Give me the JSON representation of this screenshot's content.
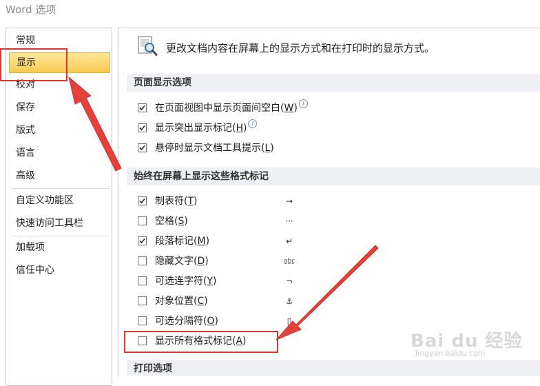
{
  "window": {
    "title": "Word 选项"
  },
  "sidebar": {
    "items": [
      {
        "label": "常规"
      },
      {
        "label": "显示",
        "selected": true
      },
      {
        "label": "校对"
      },
      {
        "label": "保存"
      },
      {
        "label": "版式"
      },
      {
        "label": "语言"
      },
      {
        "label": "高级"
      },
      {
        "label": "自定义功能区"
      },
      {
        "label": "快速访问工具栏"
      },
      {
        "label": "加载项"
      },
      {
        "label": "信任中心"
      }
    ]
  },
  "main": {
    "intro": "更改文档内容在屏幕上的显示方式和在打印时的显示方式。",
    "sections": [
      {
        "title": "页面显示选项",
        "options": [
          {
            "label": "在页面视图中显示页面间空白",
            "key": "W",
            "checked": true,
            "info": true
          },
          {
            "label": "显示突出显示标记",
            "key": "H",
            "checked": true,
            "info": true
          },
          {
            "label": "悬停时显示文档工具提示",
            "key": "L",
            "checked": true
          }
        ]
      },
      {
        "title": "始终在屏幕上显示这些格式标记",
        "options": [
          {
            "label": "制表符",
            "key": "T",
            "checked": true,
            "symbol": "→"
          },
          {
            "label": "空格",
            "key": "S",
            "checked": false,
            "symbol": "···"
          },
          {
            "label": "段落标记",
            "key": "M",
            "checked": true,
            "symbol": "↵"
          },
          {
            "label": "隐藏文字",
            "key": "D",
            "checked": false,
            "symbol": "abc"
          },
          {
            "label": "可选连字符",
            "key": "Y",
            "checked": false,
            "symbol": "¬"
          },
          {
            "label": "对象位置",
            "key": "C",
            "checked": false,
            "symbol": "⚓"
          },
          {
            "label": "可选分隔符",
            "key": "O",
            "checked": false,
            "symbol": "▯"
          },
          {
            "label": "显示所有格式标记",
            "key": "A",
            "checked": false
          }
        ]
      },
      {
        "title": "打印选项"
      }
    ]
  },
  "annotations": {
    "highlight_color": "#e1332f"
  },
  "watermark": {
    "text": "Bai du 经验",
    "url": "jingyan.baidu.com"
  }
}
